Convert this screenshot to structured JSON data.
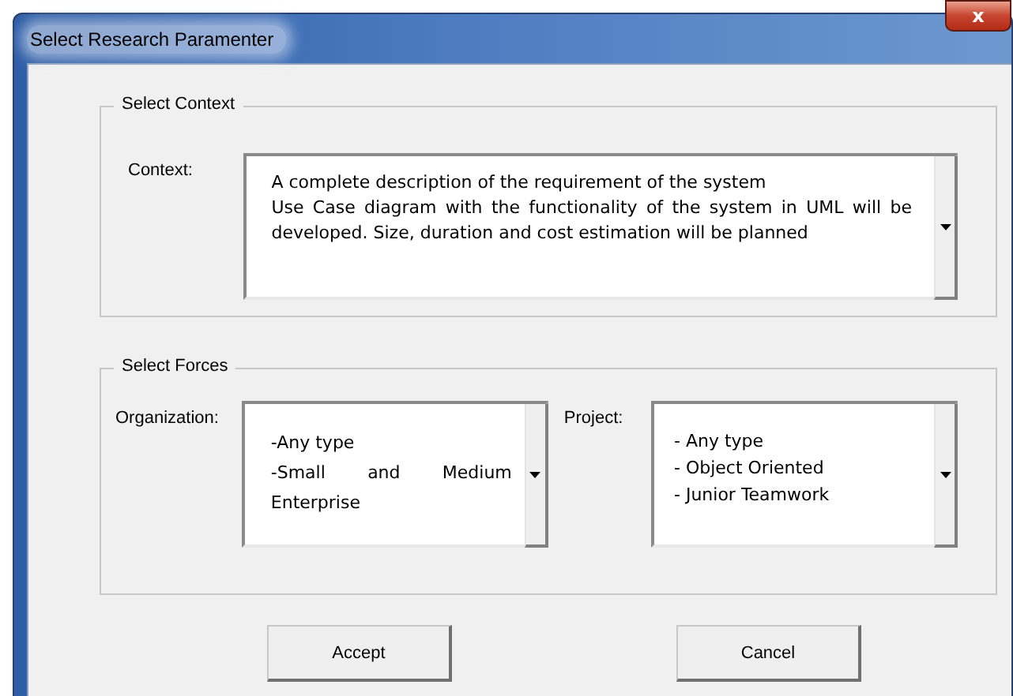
{
  "window": {
    "title": "Select Research Paramenter",
    "close": "x"
  },
  "context_group": {
    "title": "Select Context",
    "label": "Context:",
    "lines": [
      "A complete description of the requirement of the system",
      "Use Case diagram with the functionality of the system in UML will be developed. Size, duration and cost estimation will be planned"
    ]
  },
  "forces_group": {
    "title": "Select Forces",
    "fields": [
      {
        "label": "Organization:",
        "lines": [
          "-Any type",
          "-Small and Medium Enterprise"
        ]
      },
      {
        "label": "Project:",
        "lines": [
          "- Any type",
          "- Object Oriented",
          "- Junior Teamwork"
        ]
      }
    ]
  },
  "buttons": [
    "Accept",
    "Cancel"
  ]
}
